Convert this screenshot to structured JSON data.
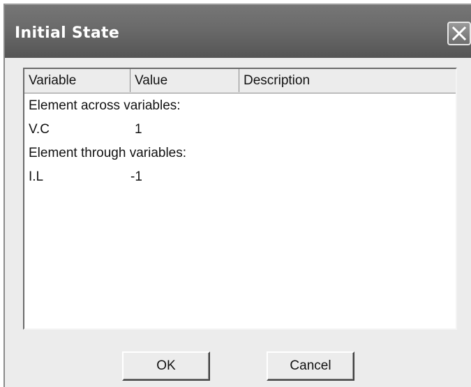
{
  "dialog": {
    "title": "Initial State",
    "close_icon": "close-icon"
  },
  "table": {
    "columns": [
      "Variable",
      "Value",
      "Description"
    ],
    "rows": [
      {
        "type": "group",
        "label": "Element across variables:"
      },
      {
        "type": "item",
        "variable": "V.C",
        "value": "1",
        "description": ""
      },
      {
        "type": "group",
        "label": "Element through variables:"
      },
      {
        "type": "item",
        "variable": "I.L",
        "value": "-1",
        "description": ""
      }
    ]
  },
  "buttons": {
    "ok": "OK",
    "cancel": "Cancel"
  }
}
